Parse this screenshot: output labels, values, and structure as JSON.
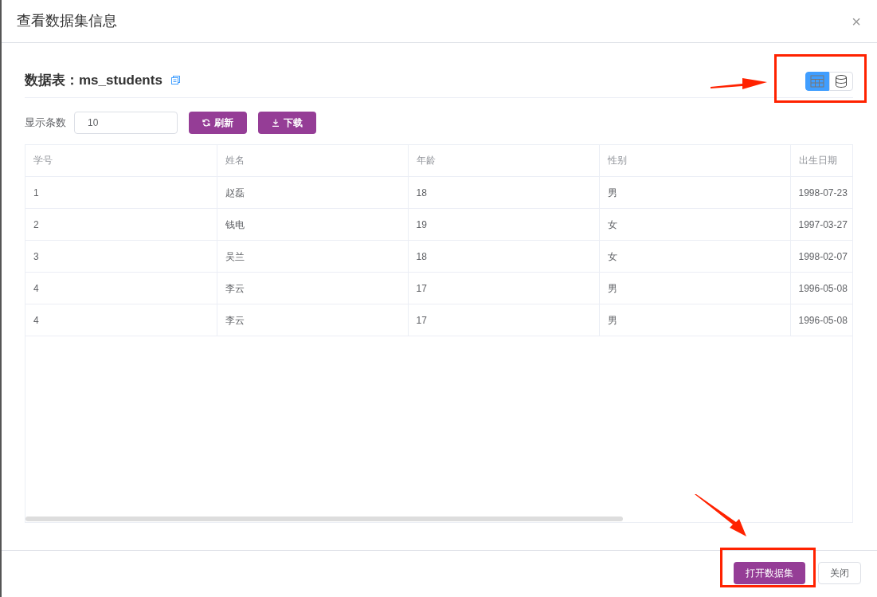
{
  "dialog": {
    "title": "查看数据集信息",
    "close": "×"
  },
  "table_title": "数据表：ms_students",
  "view_toggle": [
    {
      "kind": "table",
      "selected": true
    },
    {
      "kind": "database",
      "selected": false
    }
  ],
  "toolbar": {
    "rows_label": "显示条数",
    "rows_value": "10",
    "buttons": [
      {
        "kind": "refresh",
        "label": "刷新"
      },
      {
        "kind": "download",
        "label": "下载"
      }
    ]
  },
  "table": {
    "columns": [
      "学号",
      "姓名",
      "年龄",
      "性别",
      "出生日期"
    ],
    "rows": [
      [
        "1",
        "赵磊",
        "18",
        "男",
        "1998-07-23"
      ],
      [
        "2",
        "钱电",
        "19",
        "女",
        "1997-03-27"
      ],
      [
        "3",
        "吴兰",
        "18",
        "女",
        "1998-02-07"
      ],
      [
        "4",
        "李云",
        "17",
        "男",
        "1996-05-08"
      ],
      [
        "4",
        "李云",
        "17",
        "男",
        "1996-05-08"
      ]
    ]
  },
  "footer": {
    "primary": "打开数据集",
    "secondary": "关闭"
  }
}
